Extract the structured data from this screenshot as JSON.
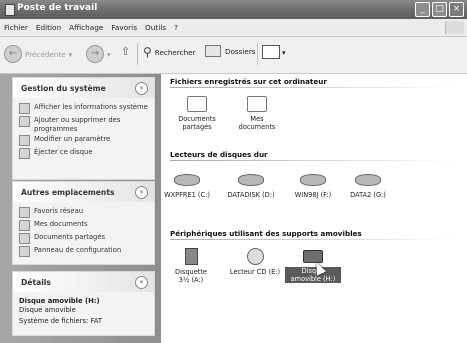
{
  "window": {
    "title": "Poste de travail"
  },
  "menu": [
    "Fichier",
    "Edition",
    "Affichage",
    "Favoris",
    "Outils",
    "?"
  ],
  "toolbar": {
    "back_label": "Précédente",
    "search_label": "Rechercher",
    "folders_label": "Dossiers"
  },
  "left": {
    "system": {
      "title": "Gestion du système",
      "items": [
        "Afficher les informations système",
        "Ajouter ou supprimer des programmes",
        "Modifier un paramètre",
        "Éjecter ce disque"
      ]
    },
    "places": {
      "title": "Autres emplacements",
      "items": [
        "Favoris réseau",
        "Mes documents",
        "Documents partagés",
        "Panneau de configuration"
      ]
    },
    "details": {
      "title": "Détails",
      "name": "Disque amovible (H:)",
      "type": "Disque amovible",
      "fs": "Système de fichiers: FAT"
    }
  },
  "groups": [
    {
      "title": "Fichiers enregistrés sur cet ordinateur",
      "items": [
        {
          "label": "Documents partagés"
        },
        {
          "label": "Mes documents"
        }
      ]
    },
    {
      "title": "Lecteurs de disques dur",
      "items": [
        {
          "label": "WXPFRE1 (C:)"
        },
        {
          "label": "DATADISK (D:)"
        },
        {
          "label": "WIN98J (F:)"
        },
        {
          "label": "DATA2 (G:)"
        }
      ]
    },
    {
      "title": "Périphériques utilisant des supports amovibles",
      "items": [
        {
          "label": "Disquette 3½ (A:)"
        },
        {
          "label": "Lecteur CD (E:)"
        },
        {
          "label": "Disque amovible (H:)"
        }
      ]
    }
  ]
}
